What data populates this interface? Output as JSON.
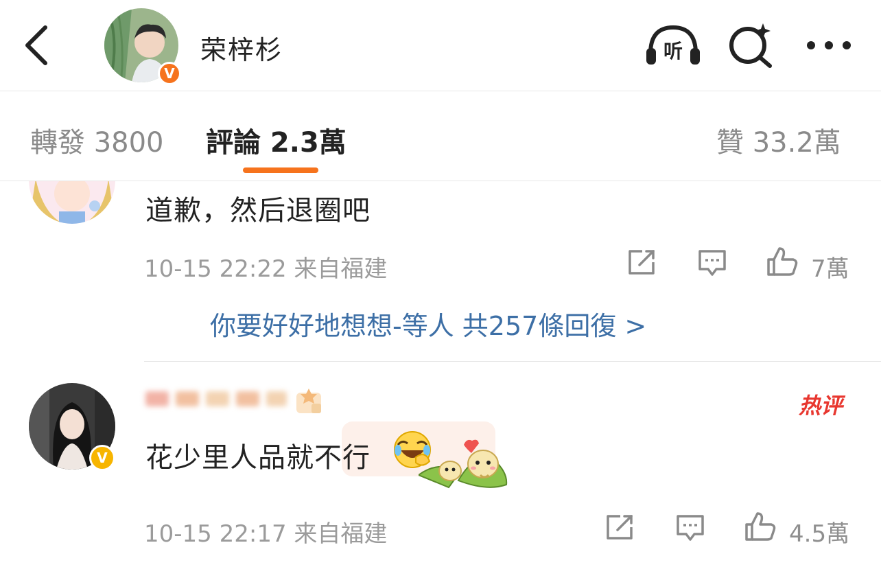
{
  "header": {
    "username": "荣梓杉",
    "listen_label": "听"
  },
  "tabs": {
    "repost": "轉發 3800",
    "comments": "評論 2.3萬",
    "likes": "贊 33.2萬"
  },
  "comments": [
    {
      "text": "道歉，然后退圈吧",
      "time": "10-15 22:22",
      "location": "来自福建",
      "likes": "7萬",
      "reply_summary": "你要好好地想想-等人 共257條回復 >"
    },
    {
      "text": "花少里人品就不行",
      "time": "10-15 22:17",
      "location": "来自福建",
      "likes": "4.5萬",
      "badge": "热评"
    }
  ],
  "colors": {
    "accent": "#f6731d",
    "link": "#3d6fa6",
    "hot": "#e8372f",
    "verified_gold": "#f7b500"
  },
  "icons": [
    "back-arrow-icon",
    "headphones-icon",
    "search-sparkle-icon",
    "more-dots-icon",
    "share-icon",
    "comment-icon",
    "thumbs-up-icon",
    "laugh-cry-emoji-icon",
    "zongzi-sticker-icon"
  ]
}
